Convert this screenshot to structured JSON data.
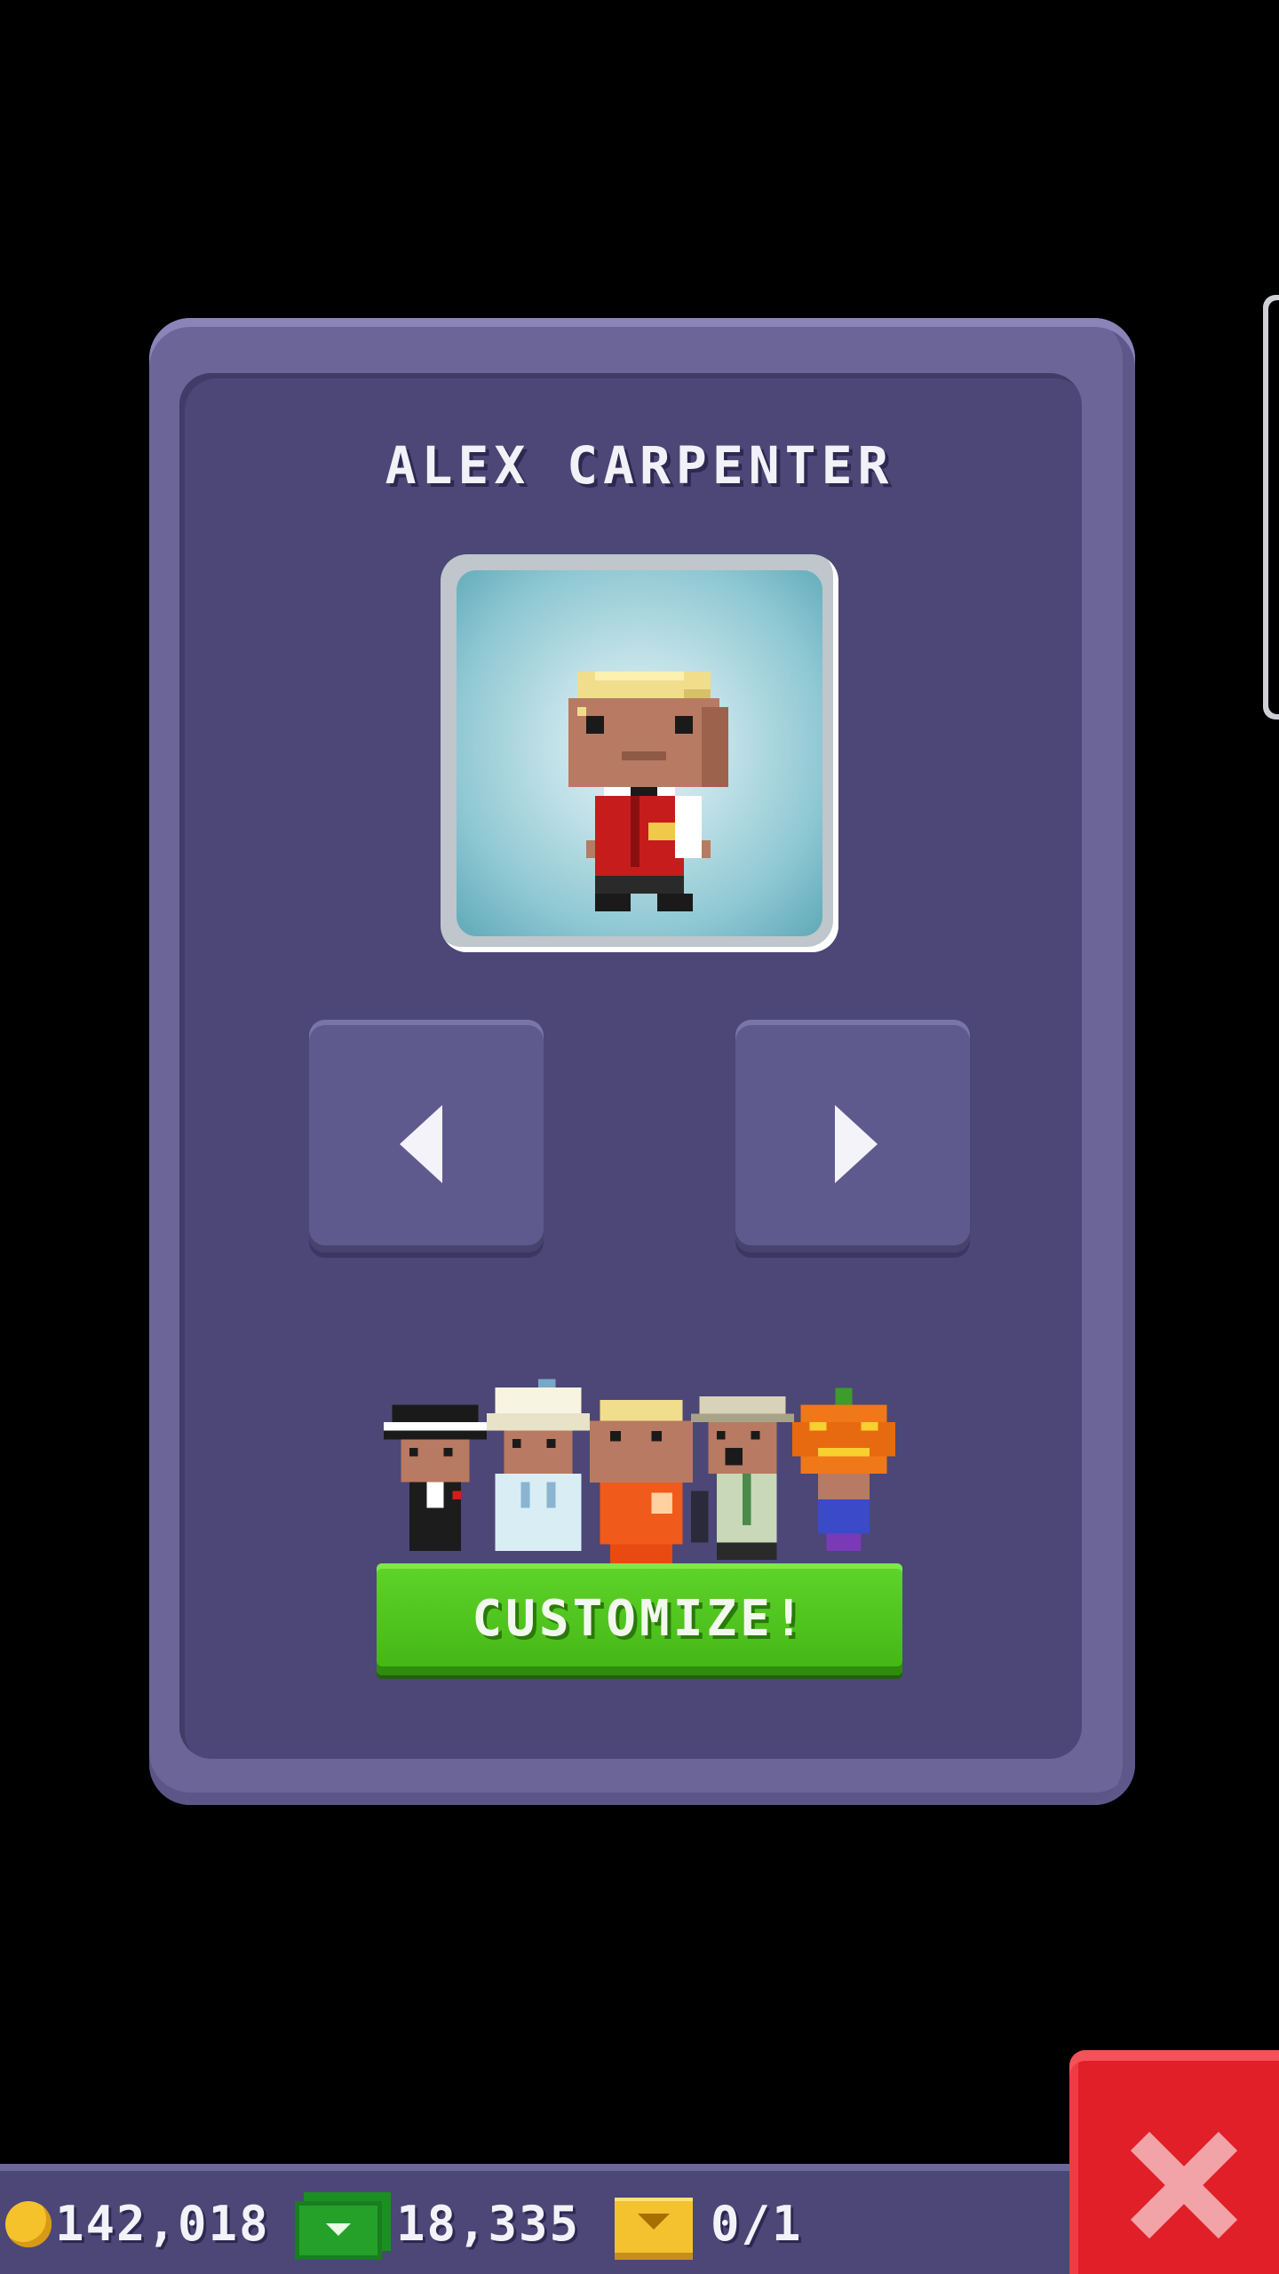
{
  "dialog": {
    "title": "ALEX CARPENTER",
    "customize_label": "CUSTOMIZE!",
    "outfits": [
      "tuxedo-fedora",
      "chef-whites",
      "orange-shirt",
      "explorer-cap",
      "pumpkin-head"
    ]
  },
  "currencies": {
    "coins": "142,018",
    "bux": "18,335",
    "tickets": "0/1"
  },
  "icons": {
    "prev": "arrow-left-icon",
    "next": "arrow-right-icon",
    "close": "close-icon",
    "coin": "coin-icon",
    "bux": "bux-icon",
    "ticket": "ticket-icon"
  },
  "colors": {
    "panel": "#6b6598",
    "panel_inner": "#4c4776",
    "customize": "#4cc01d",
    "close": "#e11f28"
  }
}
